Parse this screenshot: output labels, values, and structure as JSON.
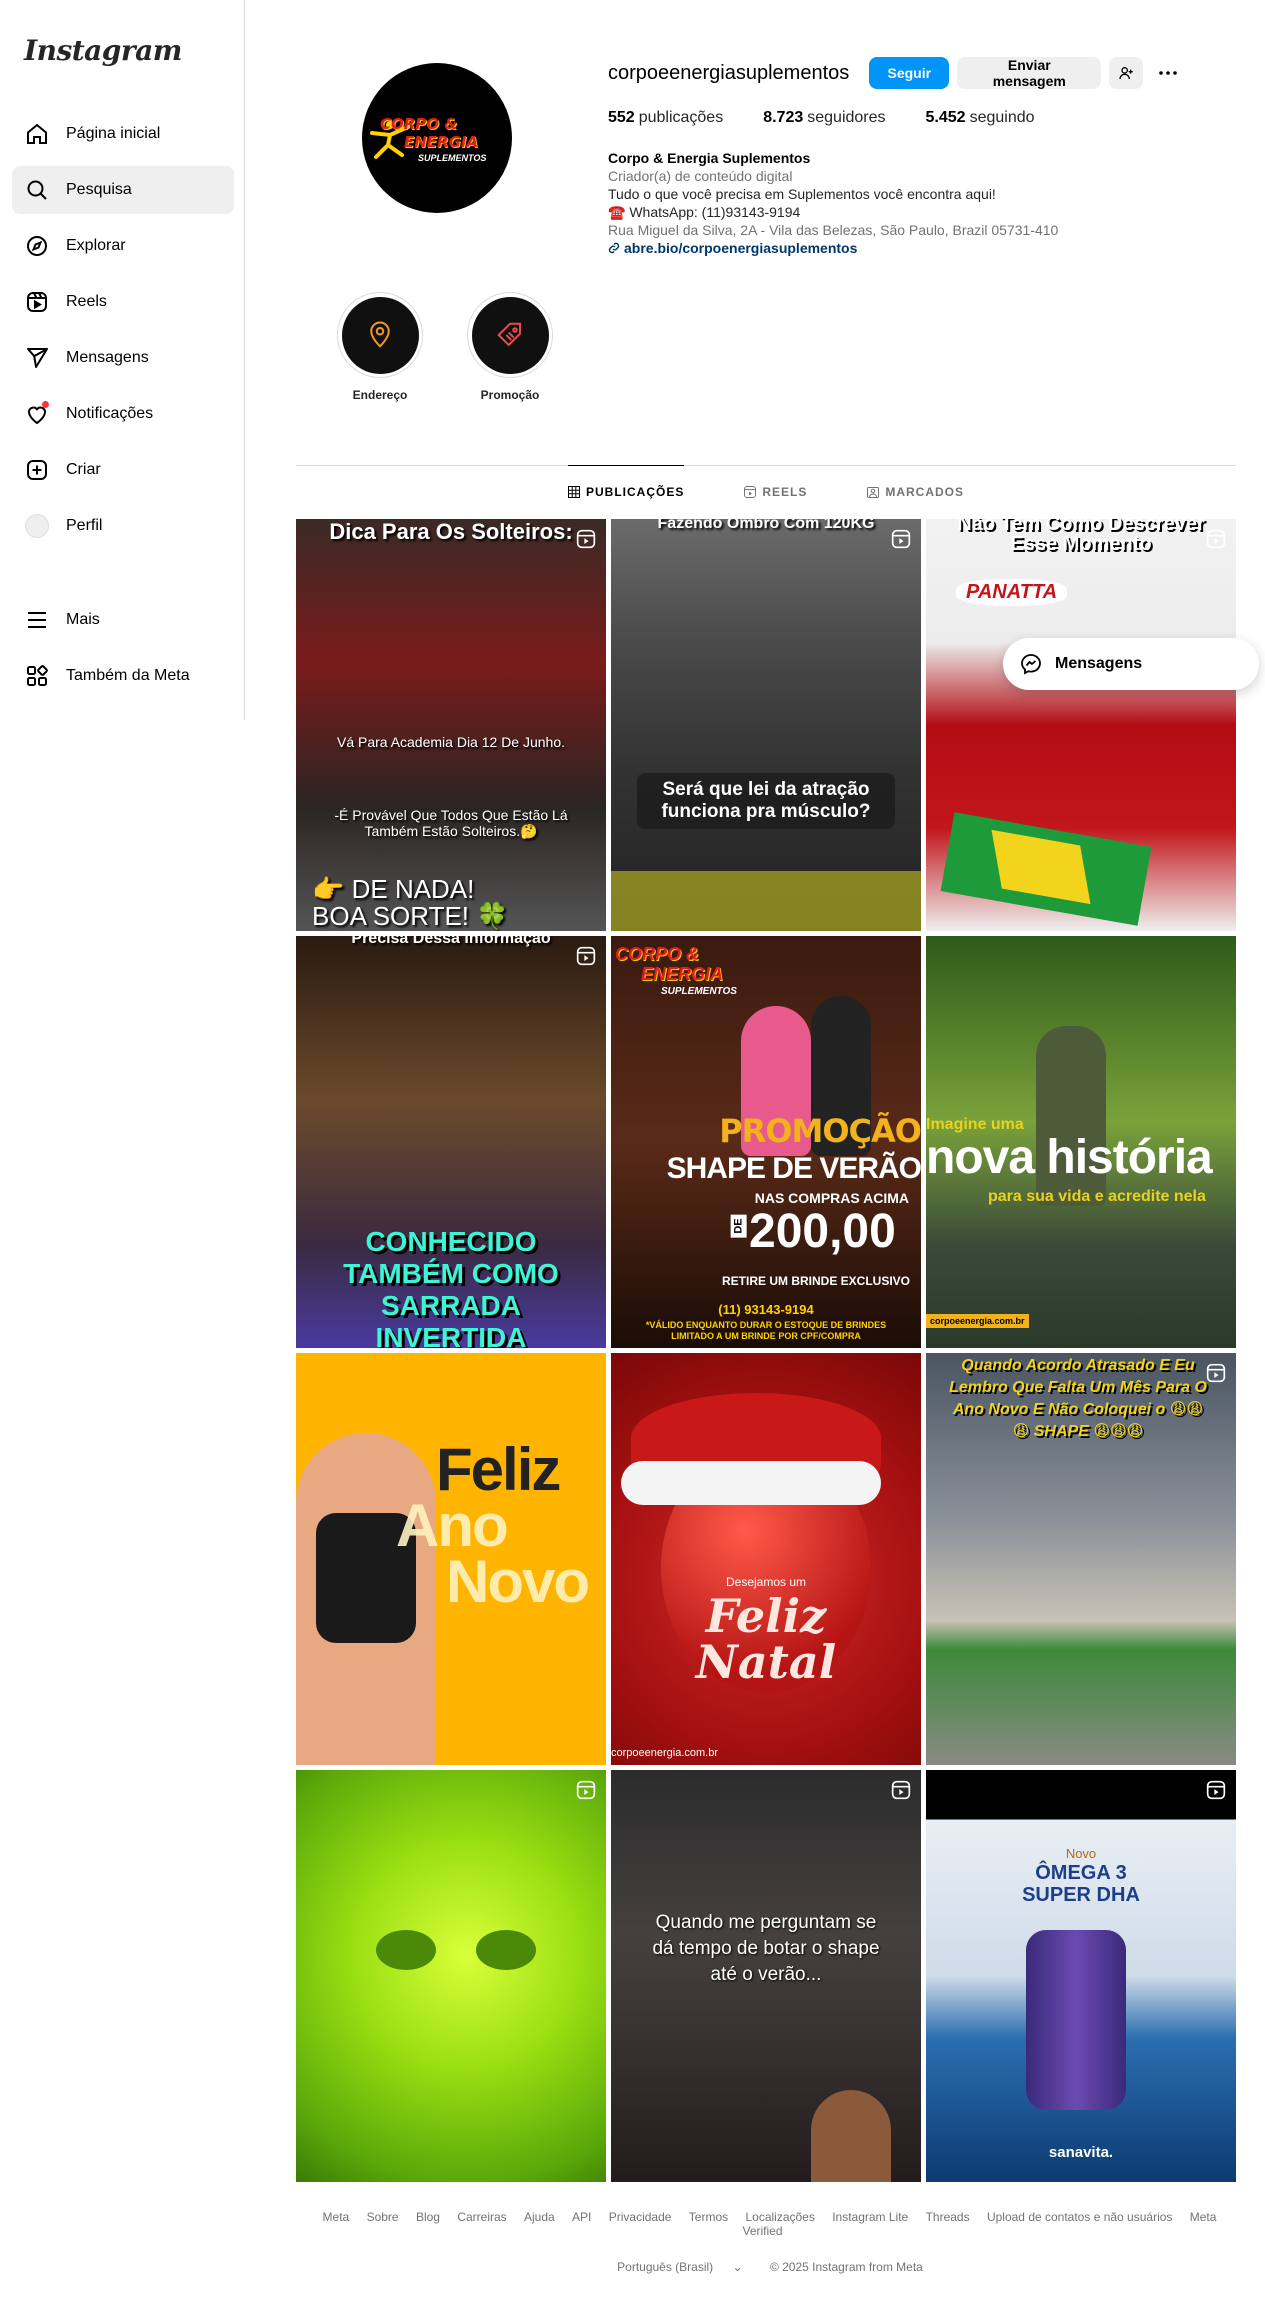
{
  "app": {
    "logo": "Instagram"
  },
  "sidebar": {
    "items": [
      {
        "label": "Página inicial",
        "icon": "home-icon"
      },
      {
        "label": "Pesquisa",
        "icon": "search-icon",
        "active": true
      },
      {
        "label": "Explorar",
        "icon": "compass-icon"
      },
      {
        "label": "Reels",
        "icon": "reels-icon"
      },
      {
        "label": "Mensagens",
        "icon": "send-icon"
      },
      {
        "label": "Notificações",
        "icon": "heart-icon"
      },
      {
        "label": "Criar",
        "icon": "plus-icon"
      },
      {
        "label": "Perfil",
        "icon": "avatar"
      }
    ],
    "bottom": [
      {
        "label": "Mais",
        "icon": "menu-icon"
      },
      {
        "label": "Também da Meta",
        "icon": "meta-icon"
      }
    ]
  },
  "profile": {
    "username": "corpoeenergiasuplementos",
    "follow_label": "Seguir",
    "message_label": "Enviar mensagem",
    "stats": {
      "posts_n": "552",
      "posts_label": "publicações",
      "followers_n": "8.723",
      "followers_label": "seguidores",
      "following_n": "5.452",
      "following_label": "seguindo"
    },
    "avatar_text": {
      "line1": "CORPO &",
      "line2": "ENERGIA",
      "line3": "SUPLEMENTOS"
    },
    "bio": {
      "name": "Corpo & Energia Suplementos",
      "category": "Criador(a) de conteúdo digital",
      "line1": "Tudo o que você precisa em Suplementos você encontra aqui!",
      "line2": "☎️ WhatsApp: (11)93143-9194",
      "address": "Rua Miguel da Silva, 2A - Vila das Belezas, São Paulo, Brazil 05731-410",
      "link": "abre.bio/corpoenergiasuplementos"
    }
  },
  "highlights": [
    {
      "label": "Endereço",
      "icon": "location-pin-icon"
    },
    {
      "label": "Promoção",
      "icon": "price-tag-icon"
    }
  ],
  "tabs": [
    {
      "label": "PUBLICAÇÕES",
      "icon": "grid-icon",
      "active": true
    },
    {
      "label": "REELS",
      "icon": "reels-icon"
    },
    {
      "label": "MARCADOS",
      "icon": "tagged-icon"
    }
  ],
  "posts": [
    {
      "reel": true,
      "top": "Dica Para Os Solteiros:",
      "mid1": "Vá Para Academia Dia 12 De Junho.",
      "mid2": "-É Provável Que Todos Que Estão Lá Também Estão Solteiros.🤔",
      "bottom1": "👉 DE NADA!",
      "bottom2": "BOA SORTE! 🍀"
    },
    {
      "reel": true,
      "top": "Fazendo Ombro Com 120KG",
      "mid": "Será que lei da atração funciona pra músculo?"
    },
    {
      "reel": true,
      "top1": "Não Tem Como Descrever",
      "top2": "Esse Momento",
      "brand": "PANATTA"
    },
    {
      "reel": true,
      "top": "Precisa Dessa Informação",
      "bottom": "CONHECIDO TAMBÉM COMO SARRADA INVERTIDA"
    },
    {
      "reel": false,
      "brand1": "CORPO &",
      "brand2": "ENERGIA",
      "brand3": "SUPLEMENTOS",
      "promo": "PROMOÇÃO",
      "shape": "SHAPE DE VERÃO",
      "compras": "NAS COMPRAS ACIMA",
      "de": "DE",
      "valor": "200,00",
      "brinde": "RETIRE UM BRINDE EXCLUSIVO",
      "phone": "(11) 93143-9194",
      "aviso": "*VÁLIDO ENQUANTO DURAR O ESTOQUE DE BRINDES LIMITADO A UM BRINDE POR CPF/COMPRA"
    },
    {
      "reel": false,
      "l1": "Imagine uma",
      "l2": "nova história",
      "l3": "para sua vida e acredite nela",
      "site": "corpoeenergia.com.br"
    },
    {
      "reel": false,
      "l1": "Feliz",
      "l2": "Ano",
      "l3": "Novo"
    },
    {
      "reel": false,
      "sub": "Desejamos um",
      "l1": "Feliz",
      "l2": "Natal",
      "site": "corpoeenergia.com.br"
    },
    {
      "reel": true,
      "top": "Quando Acordo Atrasado E Eu Lembro Que Falta Um Mês Para O Ano Novo E Não Coloquei o 😩😩😩 SHAPE 😩😩😩"
    },
    {
      "reel": true
    },
    {
      "reel": true,
      "mid": "Quando me perguntam se dá tempo de botar o shape até o verão..."
    },
    {
      "reel": true,
      "novo": "Novo",
      "l1": "ÔMEGA 3",
      "l2": "SUPER DHA",
      "brand": "sanavita."
    }
  ],
  "floating": {
    "label": "Mensagens"
  },
  "footer": {
    "links": [
      "Meta",
      "Sobre",
      "Blog",
      "Carreiras",
      "Ajuda",
      "API",
      "Privacidade",
      "Termos",
      "Localizações",
      "Instagram Lite",
      "Threads",
      "Upload de contatos e não usuários",
      "Meta Verified"
    ],
    "language": "Português (Brasil)",
    "copyright": "© 2025 Instagram from Meta"
  }
}
